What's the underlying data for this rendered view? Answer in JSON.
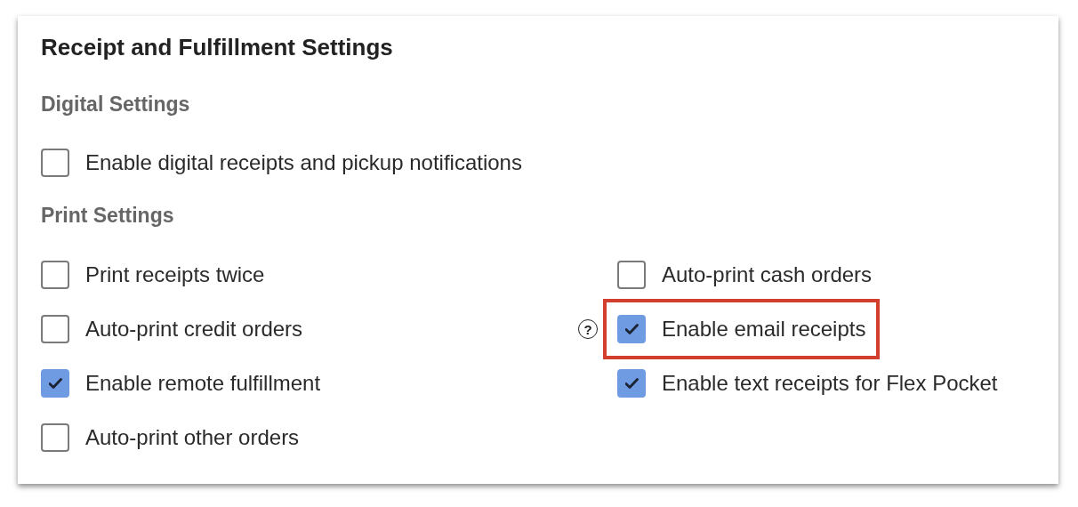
{
  "title": "Receipt and Fulfillment Settings",
  "digital_settings": {
    "heading": "Digital Settings",
    "options": [
      {
        "label": "Enable digital receipts and pickup notifications",
        "checked": false
      }
    ]
  },
  "print_settings": {
    "heading": "Print Settings",
    "columns": [
      [
        {
          "label": "Print receipts twice",
          "checked": false
        },
        {
          "label": "Auto-print credit orders",
          "checked": false
        },
        {
          "label": "Enable remote fulfillment",
          "checked": true
        },
        {
          "label": "Auto-print other orders",
          "checked": false
        }
      ],
      [
        {
          "label": "Auto-print cash orders",
          "checked": false
        },
        {
          "label": "Enable email receipts",
          "checked": true,
          "help": "?",
          "highlighted": true
        },
        {
          "label": "Enable text receipts for Flex Pocket",
          "checked": true
        }
      ]
    ]
  }
}
